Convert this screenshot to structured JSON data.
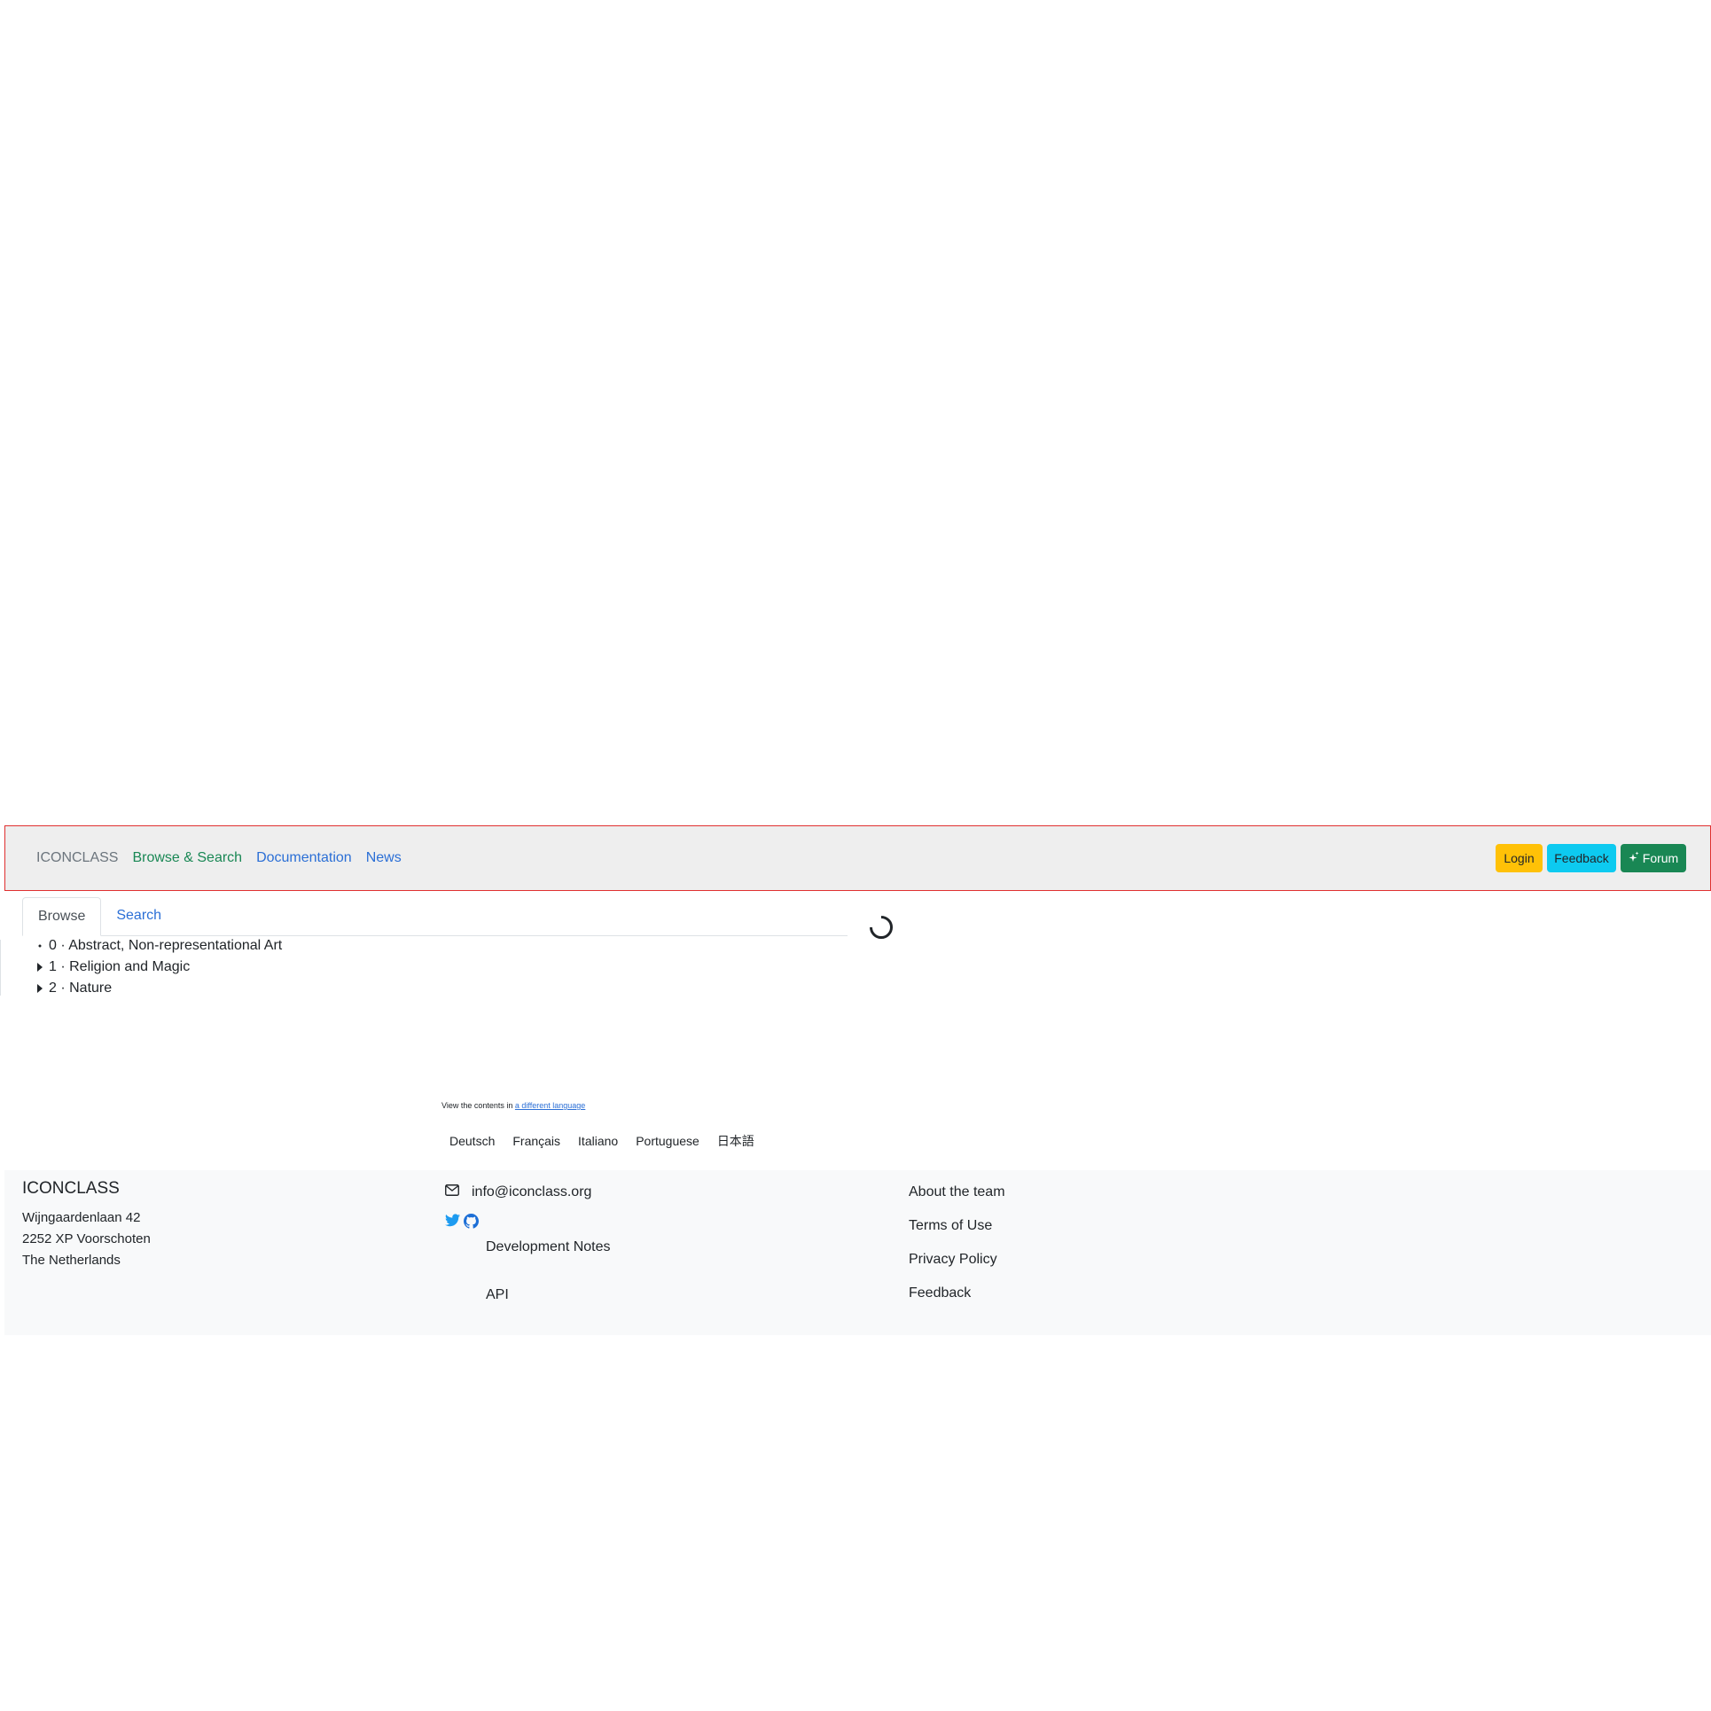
{
  "navbar": {
    "brand": "ICONCLASS",
    "links": [
      "Browse & Search",
      "Documentation",
      "News"
    ],
    "buttons": {
      "login": "Login",
      "feedback": "Feedback",
      "forum": "Forum"
    }
  },
  "tabs": [
    "Browse",
    "Search"
  ],
  "tree": [
    {
      "label": "0 · Abstract, Non-representational Art",
      "marker": "bullet"
    },
    {
      "label": "1 · Religion and Magic",
      "marker": "caret-right"
    },
    {
      "label": "2 · Nature",
      "marker": "caret-right"
    }
  ],
  "language": {
    "note_prefix": "View the contents in",
    "note_link": "a different language",
    "options": [
      "Deutsch",
      "Français",
      "Italiano",
      "Portuguese",
      "日本語"
    ]
  },
  "footer": {
    "brand": "ICONCLASS",
    "address": [
      "Wijngaardenlaan 42",
      "2252 XP Voorschoten",
      "The Netherlands"
    ],
    "email": "info@iconclass.org",
    "dev_notes": "Development Notes",
    "api": "API",
    "links": [
      "About the team",
      "Terms of Use",
      "Privacy Policy",
      "Feedback"
    ]
  },
  "colors": {
    "nav_bg": "#eeeeee",
    "link": "#2b6fd6",
    "active_link": "#198754",
    "login_btn": "#ffc107",
    "feedback_btn": "#0dcaf0",
    "forum_btn": "#198754",
    "footer_bg": "#f8f9fa"
  }
}
